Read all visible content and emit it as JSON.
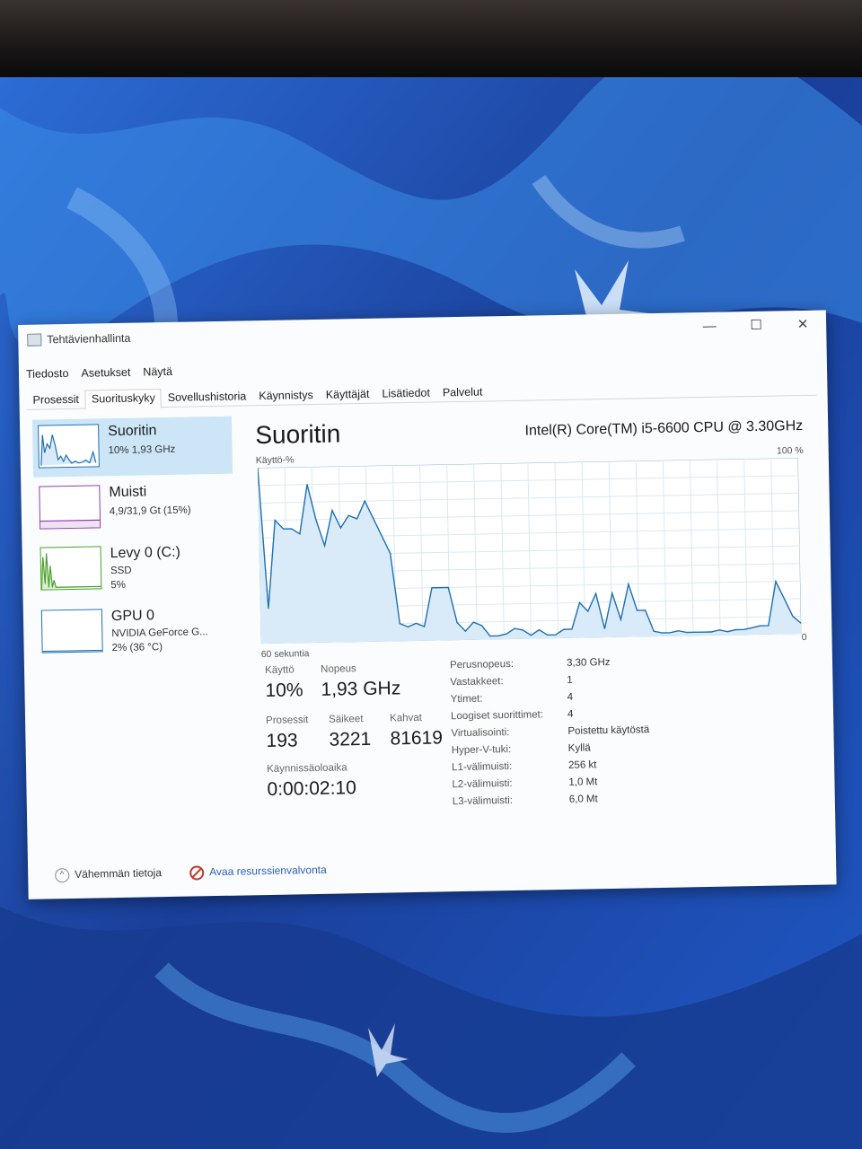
{
  "window": {
    "title": "Tehtävienhallinta",
    "minimize_symbol": "—",
    "maximize_symbol": "☐",
    "close_symbol": "✕"
  },
  "menu": [
    "Tiedosto",
    "Asetukset",
    "Näytä"
  ],
  "tabs": [
    {
      "label": "Prosessit",
      "active": false
    },
    {
      "label": "Suorituskyky",
      "active": true
    },
    {
      "label": "Sovellushistoria",
      "active": false
    },
    {
      "label": "Käynnistys",
      "active": false
    },
    {
      "label": "Käyttäjät",
      "active": false
    },
    {
      "label": "Lisätiedot",
      "active": false
    },
    {
      "label": "Palvelut",
      "active": false
    }
  ],
  "sidebar": {
    "items": [
      {
        "name": "Suoritin",
        "sub1": "10%  1,93 GHz",
        "sub2": "",
        "color": "#1f6fb2",
        "active": true
      },
      {
        "name": "Muisti",
        "sub1": "4,9/31,9 Gt (15%)",
        "sub2": "",
        "color": "#8b3fa8",
        "active": false
      },
      {
        "name": "Levy 0 (C:)",
        "sub1": "SSD",
        "sub2": "5%",
        "color": "#4aa02c",
        "active": false
      },
      {
        "name": "GPU 0",
        "sub1": "NVIDIA GeForce G...",
        "sub2": "2% (36 °C)",
        "color": "#1f6fb2",
        "active": false
      }
    ]
  },
  "main": {
    "title": "Suoritin",
    "cpu_model": "Intel(R) Core(TM) i5-6600 CPU @ 3.30GHz",
    "graph": {
      "y_label": "Käyttö-%",
      "y_max_label": "100 %",
      "y_min_label": "0",
      "x_label": "60 sekuntia",
      "line_color": "#1f6fb2",
      "fill_color": "#d9ebf8",
      "grid_color": "#dbe8f3"
    },
    "stats": {
      "usage_label": "Käyttö",
      "usage_value": "10%",
      "speed_label": "Nopeus",
      "speed_value": "1,93 GHz",
      "processes_label": "Prosessit",
      "processes_value": "193",
      "threads_label": "Säikeet",
      "threads_value": "3221",
      "handles_label": "Kahvat",
      "handles_value": "81619",
      "uptime_label": "Käynnissäoloaika",
      "uptime_value": "0:00:02:10"
    },
    "specs": [
      {
        "key": "Perusnopeus:",
        "value": "3,30 GHz"
      },
      {
        "key": "Vastakkeet:",
        "value": "1"
      },
      {
        "key": "Ytimet:",
        "value": "4"
      },
      {
        "key": "Loogiset suorittimet:",
        "value": "4"
      },
      {
        "key": "Virtualisointi:",
        "value": "Poistettu käytöstä"
      },
      {
        "key": "Hyper-V-tuki:",
        "value": "Kyllä"
      },
      {
        "key": "L1-välimuisti:",
        "value": "256 kt"
      },
      {
        "key": "L2-välimuisti:",
        "value": "1,0 Mt"
      },
      {
        "key": "L3-välimuisti:",
        "value": "6,0 Mt"
      }
    ]
  },
  "footer": {
    "fewer_details": "Vähemmän tietoja",
    "open_resmon": "Avaa resurssienvalvonta"
  },
  "chart_data": {
    "type": "area",
    "y_label": "Käyttö-%",
    "x_label": "60 sekuntia",
    "ylim": [
      0,
      100
    ],
    "values": [
      100,
      20,
      70,
      65,
      65,
      62,
      90,
      70,
      55,
      75,
      65,
      72,
      70,
      80,
      70,
      60,
      50,
      10,
      8,
      10,
      8,
      30,
      30,
      30,
      10,
      5,
      10,
      8,
      2,
      2,
      3,
      6,
      5,
      2,
      5,
      2,
      2,
      5,
      5,
      20,
      15,
      25,
      5,
      25,
      10,
      30,
      15,
      15,
      3,
      2,
      2,
      3,
      2,
      2,
      2,
      2,
      3,
      2,
      3,
      3,
      4,
      5,
      5,
      30,
      20,
      10,
      6
    ],
    "series": [
      {
        "name": "",
        "values": []
      }
    ]
  }
}
